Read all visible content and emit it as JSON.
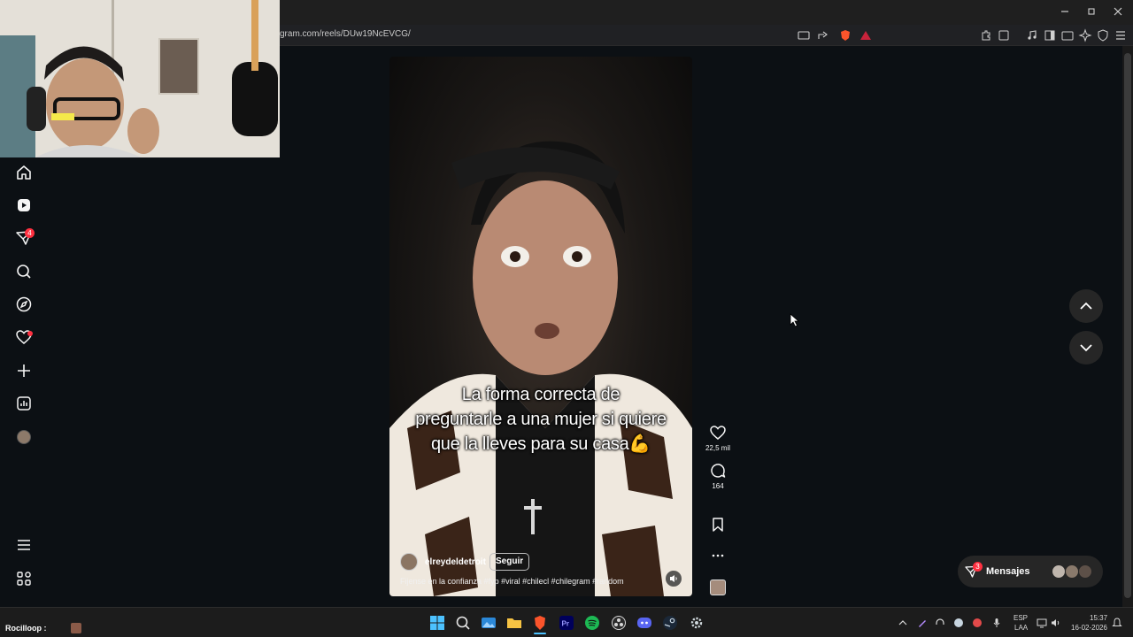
{
  "browser": {
    "url": "gram.com/reels/DUw19NcEVCG/"
  },
  "sidebar": {
    "notifications_badge": "4"
  },
  "reel": {
    "overlay_lines": [
      "La forma correcta de",
      "preguntarle a una mujer si quiere",
      "que la lleves para su casa💪"
    ],
    "username": "elreydeldetroit",
    "follow_label": "Seguir",
    "description": "Fijense en la confianza #fyp #viral #chilecl #chilegram #random",
    "likes": "22,5 mil",
    "comments": "164"
  },
  "messages": {
    "label": "Mensajes",
    "badge": "3"
  },
  "stream": {
    "chat_user": "Rocilloop :"
  },
  "taskbar": {
    "language": "ESP",
    "layout": "LAA",
    "time": "15:37",
    "date": "16-02-2026"
  },
  "colors": {
    "background": "#0c1014",
    "accent_badge": "#ff3040",
    "spotify": "#1db954",
    "brave": "#fb542b"
  }
}
